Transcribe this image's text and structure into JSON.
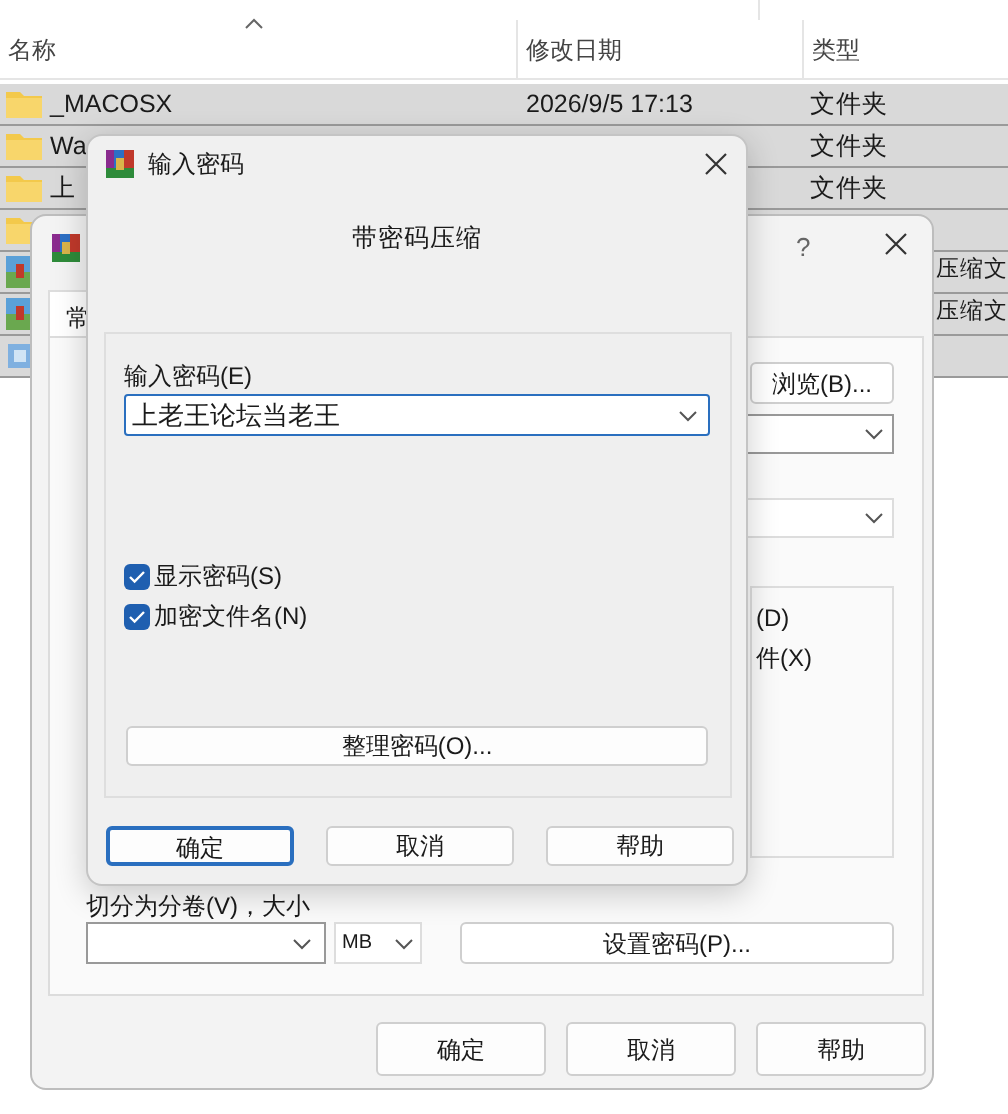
{
  "explorer": {
    "columns": [
      {
        "label": "名称",
        "sorted": true
      },
      {
        "label": "修改日期",
        "sorted": false
      },
      {
        "label": "类型",
        "sorted": false
      }
    ],
    "rows": [
      {
        "kind": "folder",
        "name": "_MACOSX",
        "date": "2026/9/5 17:13",
        "type": "文件夹",
        "selected": true
      },
      {
        "kind": "folder",
        "name": "Wa",
        "type": "文件夹",
        "selected": true
      },
      {
        "kind": "folder",
        "name": "上",
        "type": "文件夹",
        "selected": true
      },
      {
        "kind": "folder",
        "selected": true
      },
      {
        "kind": "archive",
        "type": "压缩文",
        "selected": true
      },
      {
        "kind": "archive",
        "type": "压缩文",
        "selected": true
      },
      {
        "kind": "file",
        "selected": true
      }
    ]
  },
  "archive_dialog": {
    "help": "?",
    "tab": "常",
    "browse_button": "浏览(B)...",
    "options": [
      "(D)",
      "件(X)"
    ],
    "split_label": "切分为分卷(V)，大小",
    "unit": "MB",
    "password_button": "设置密码(P)...",
    "buttons": [
      {
        "label": "确定",
        "default": false
      },
      {
        "label": "取消",
        "default": false
      },
      {
        "label": "帮助",
        "default": false
      }
    ]
  },
  "password_dialog": {
    "title": "输入密码",
    "heading": "带密码压缩",
    "password_label": "输入密码(E)",
    "password": "上老王论坛当老王",
    "checkboxes": [
      {
        "label": "显示密码(S)",
        "checked": true
      },
      {
        "label": "加密文件名(N)",
        "checked": true
      }
    ],
    "organize_button": "整理密码(O)...",
    "buttons": [
      {
        "label": "确定",
        "default": true
      },
      {
        "label": "取消",
        "default": false
      },
      {
        "label": "帮助",
        "default": false
      }
    ]
  }
}
